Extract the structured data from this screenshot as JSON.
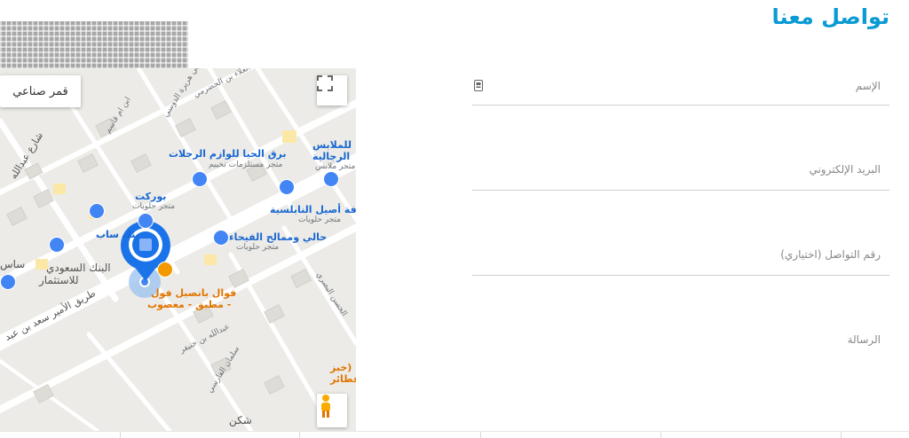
{
  "page": {
    "title": "تواصل معنا"
  },
  "map": {
    "satellite_label": "قمر صناعي",
    "fullscreen_icon": "fullscreen-icon",
    "pegman_icon": "pegman-icon",
    "labels": {
      "store1": "برق الحيا للوازم الرحلات",
      "store1_sub": "متجر مستلزمات تخييم",
      "store2": "للملابس",
      "store2b": "الرجالية",
      "store2_sub": "متجر ملابس",
      "sweets1": "بوركت",
      "sweets1_sub": "متجر حلويات",
      "bank1": "بنك ساب",
      "bank2": "البنك السعودي",
      "bank2b": "للاستثمار",
      "sweets2": "افة أصيل النابلسية",
      "sweets2_sub": "متجر حلويات",
      "sweets3": "حالي وممالح الفيحاء",
      "sweets3_sub": "متجر حلويات",
      "rest1": "فوال بانصيل فول",
      "rest1b": "- مطبق - معصوب",
      "street1": "شارع عبدالله",
      "street2": "طريق الأمير سعد بن عبد",
      "street3": "عبدالله بن خنيفر",
      "street4": "ابن ام قاسم",
      "street5": "ابي هريرة الدوسي",
      "street6": "سلمان الفارسي",
      "street7": "الحسن البصري",
      "street8": "العلاء بن الحضرمي",
      "place1": "شكن",
      "place2": "(خبز",
      "place2b": "-فطائر",
      "place3": "ساس"
    }
  },
  "form": {
    "name_placeholder": "الإسم",
    "email_placeholder": "البريد الإلكتروني",
    "phone_placeholder": "رقم التواصل (اختياري)",
    "message_placeholder": "الرسالة",
    "name_icon": "contact-card-icon"
  }
}
